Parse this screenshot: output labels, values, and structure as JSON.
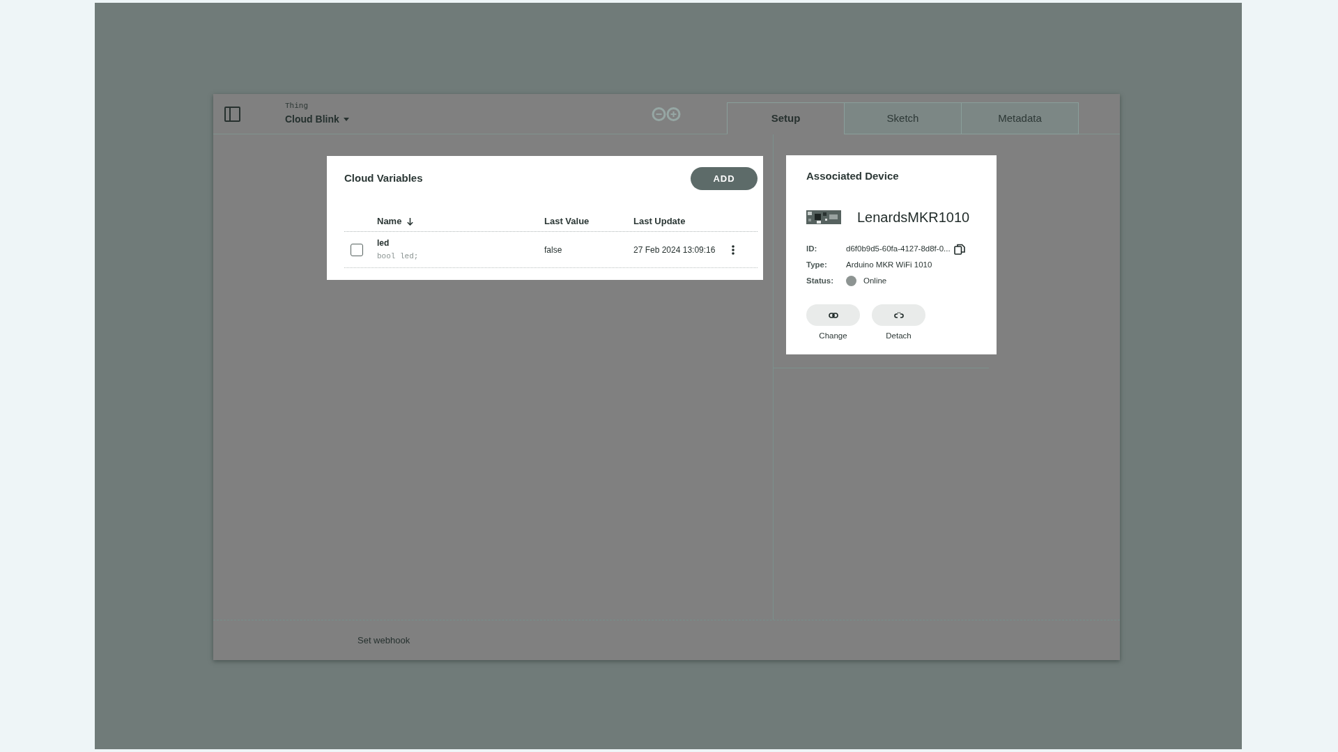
{
  "header": {
    "label": "Thing",
    "title": "Cloud Blink"
  },
  "tabs": [
    {
      "label": "Setup",
      "selected": true
    },
    {
      "label": "Sketch",
      "selected": false
    },
    {
      "label": "Metadata",
      "selected": false
    }
  ],
  "cloud_variables": {
    "title": "Cloud Variables",
    "add_button": "ADD",
    "columns": [
      {
        "label": "Name",
        "sorted": true
      },
      {
        "label": "Last Value",
        "sorted": false
      },
      {
        "label": "Last Update",
        "sorted": false
      }
    ],
    "rows": [
      {
        "name": "led",
        "declaration": "bool led;",
        "last_value": "false",
        "last_update": "27 Feb 2024 13:09:16",
        "checked": false
      }
    ]
  },
  "associated_device": {
    "title": "Associated Device",
    "name": "LenardsMKR1010",
    "fields": [
      {
        "kind": "copyable",
        "label": "ID:",
        "value": "d6f0b9d5-60fa-4127-8d8f-0..."
      },
      {
        "kind": "text",
        "label": "Type:",
        "value": "Arduino MKR WiFi 1010"
      },
      {
        "kind": "status",
        "label": "Status:",
        "value": "Online"
      }
    ],
    "actions": [
      {
        "kind": "link",
        "label": "Change"
      },
      {
        "kind": "unlink",
        "label": "Detach"
      }
    ]
  },
  "footer": {
    "link": "Set webhook"
  }
}
